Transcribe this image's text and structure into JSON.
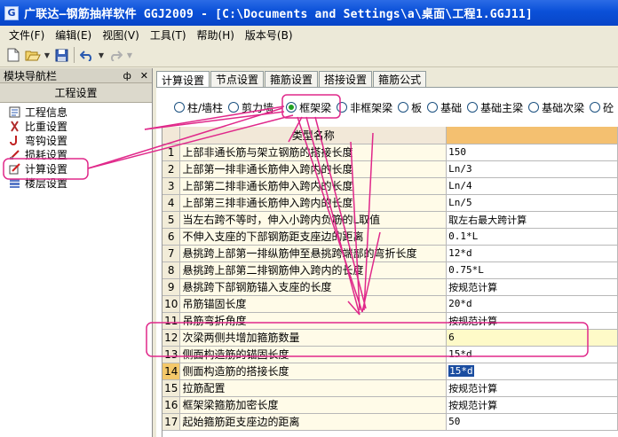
{
  "window": {
    "title": "广联达—钢筋抽样软件 GGJ2009 - [C:\\Documents and Settings\\a\\桌面\\工程1.GGJ11]"
  },
  "menu": [
    "文件(F)",
    "编辑(E)",
    "视图(V)",
    "工具(T)",
    "帮助(H)",
    "版本号(B)"
  ],
  "toolbar": {
    "icons": [
      "new-icon",
      "open-icon",
      "save-icon",
      "undo-icon",
      "redo-icon"
    ]
  },
  "nav": {
    "title": "模块导航栏",
    "pin": "ф",
    "close": "✕",
    "group": "工程设置",
    "items": [
      {
        "label": "工程信息",
        "icon": "info-icon"
      },
      {
        "label": "比重设置",
        "icon": "weight-icon"
      },
      {
        "label": "弯钩设置",
        "icon": "hook-icon"
      },
      {
        "label": "损耗设置",
        "icon": "loss-icon"
      },
      {
        "label": "计算设置",
        "icon": "calc-icon"
      },
      {
        "label": "楼层设置",
        "icon": "floor-icon"
      }
    ]
  },
  "tabs": [
    "计算设置",
    "节点设置",
    "箍筋设置",
    "搭接设置",
    "箍筋公式"
  ],
  "radios": [
    "柱/墙柱",
    "剪力墙",
    "框架梁",
    "非框架梁",
    "板",
    "基础",
    "基础主梁",
    "基础次梁",
    "砼"
  ],
  "grid": {
    "header": "类型名称",
    "rows": [
      {
        "n": "1",
        "name": "上部非通长筋与架立钢筋的搭接长度",
        "value": "150"
      },
      {
        "n": "2",
        "name": "上部第一排非通长筋伸入跨内的长度",
        "value": "Ln/3"
      },
      {
        "n": "3",
        "name": "上部第二排非通长筋伸入跨内的长度",
        "value": "Ln/4"
      },
      {
        "n": "4",
        "name": "上部第三排非通长筋伸入跨内的长度",
        "value": "Ln/5"
      },
      {
        "n": "5",
        "name": "当左右跨不等时，伸入小跨内负筋的L取值",
        "value": "取左右最大跨计算"
      },
      {
        "n": "6",
        "name": "不伸入支座的下部钢筋距支座边的距离",
        "value": "0.1*L"
      },
      {
        "n": "7",
        "name": "悬挑跨上部第一排纵筋伸至悬挑跨端部的弯折长度",
        "value": "12*d"
      },
      {
        "n": "8",
        "name": "悬挑跨上部第二排钢筋伸入跨内的长度",
        "value": "0.75*L"
      },
      {
        "n": "9",
        "name": "悬挑跨下部钢筋锚入支座的长度",
        "value": "按规范计算"
      },
      {
        "n": "10",
        "name": "吊筋锚固长度",
        "value": "20*d"
      },
      {
        "n": "11",
        "name": "吊筋弯折角度",
        "value": "按规范计算"
      },
      {
        "n": "12",
        "name": "次梁两侧共增加箍筋数量",
        "value": "6"
      },
      {
        "n": "13",
        "name": "侧面构造筋的锚固长度",
        "value": "15*d"
      },
      {
        "n": "14",
        "name": "侧面构造筋的搭接长度",
        "value": "15*d"
      },
      {
        "n": "15",
        "name": "拉筋配置",
        "value": "按规范计算"
      },
      {
        "n": "16",
        "name": "框架梁箍筋加密长度",
        "value": "按规范计算"
      },
      {
        "n": "17",
        "name": "起始箍筋距支座边的距离",
        "value": "50"
      }
    ]
  },
  "annotation_color": "#e0288a"
}
